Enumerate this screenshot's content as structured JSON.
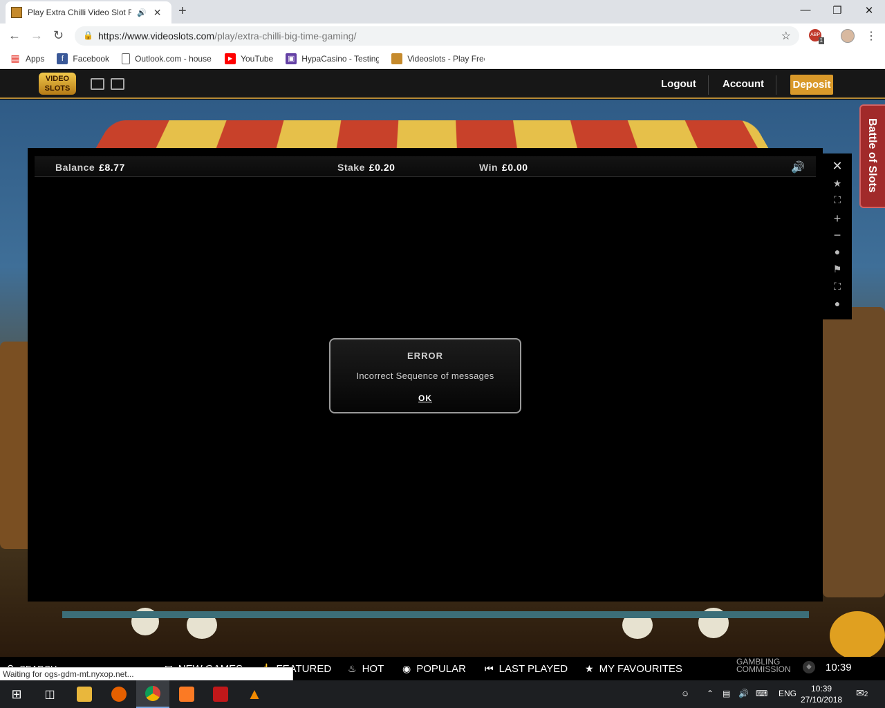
{
  "browser": {
    "tab_title": "Play Extra Chilli Video Slot Fr",
    "new_tab": "+",
    "url_host": "https://www.videoslots.com",
    "url_path": "/play/extra-chilli-big-time-gaming/",
    "abp_badge": "ABP",
    "abp_count": "1",
    "bookmarks": [
      {
        "label": "Apps",
        "color": "#e8453c"
      },
      {
        "label": "Facebook",
        "color": "#3b5998"
      },
      {
        "label": "Outlook.com - house",
        "color": "#ffffff"
      },
      {
        "label": "YouTube",
        "color": "#ff0000"
      },
      {
        "label": "HypaCasino - Testing",
        "color": "#6441a5"
      },
      {
        "label": "Videoslots - Play Free",
        "color": "#c58a2c"
      }
    ]
  },
  "site": {
    "logo_text": "VIDEO SLOTS",
    "logout": "Logout",
    "account": "Account",
    "deposit": "Deposit",
    "battle": "Battle of Slots"
  },
  "game": {
    "balance_label": "Balance",
    "balance_value": "£8.77",
    "stake_label": "Stake",
    "stake_value": "£0.20",
    "win_label": "Win",
    "win_value": "£0.00",
    "error_title": "ERROR",
    "error_message": "Incorrect Sequence of messages",
    "error_ok": "OK"
  },
  "bottom_nav": {
    "search": "SEARCH",
    "new_games": "NEW GAMES",
    "featured": "FEATURED",
    "hot": "HOT",
    "popular": "POPULAR",
    "last_played": "LAST PLAYED",
    "favourites": "MY FAVOURITES",
    "gambling_line1": "GAMBLING",
    "gambling_line2": "COMMISSION",
    "clock": "10:39"
  },
  "status": "Waiting for ogs-gdm-mt.nyxop.net...",
  "taskbar": {
    "lang": "ENG",
    "time": "10:39",
    "date": "27/10/2018",
    "notifications": "2"
  },
  "colors": {
    "accent": "#d9992a",
    "battle": "#a12a2a"
  }
}
